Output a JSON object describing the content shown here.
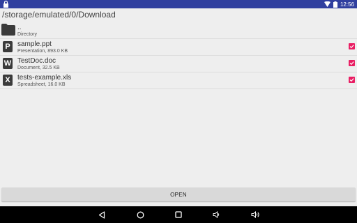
{
  "status_bar": {
    "time": "12:56",
    "icons": [
      "lock-icon",
      "wifi-icon",
      "battery-icon"
    ],
    "color": "#303f9f"
  },
  "location": {
    "path": "/storage/emulated/0/Download"
  },
  "parent": {
    "name": "..",
    "meta": "Directory",
    "icon": "folder-icon"
  },
  "files": [
    {
      "name": "sample.ppt",
      "meta": "Presentation, 893.0 KB",
      "icon_letter": "P",
      "checked": true
    },
    {
      "name": "TestDoc.doc",
      "meta": "Document, 32.5 KB",
      "icon_letter": "W",
      "checked": true
    },
    {
      "name": "tests-example.xls",
      "meta": "Spreadsheet, 16.0 KB",
      "icon_letter": "X",
      "checked": true
    }
  ],
  "actions": {
    "open_label": "OPEN"
  },
  "colors": {
    "checkbox": "#e91e63",
    "background": "#eeeeee",
    "button": "#d9d9d9"
  },
  "nav_bar": {
    "buttons": [
      "back-icon",
      "home-icon",
      "recents-icon",
      "volume-down-icon",
      "volume-up-icon"
    ]
  }
}
